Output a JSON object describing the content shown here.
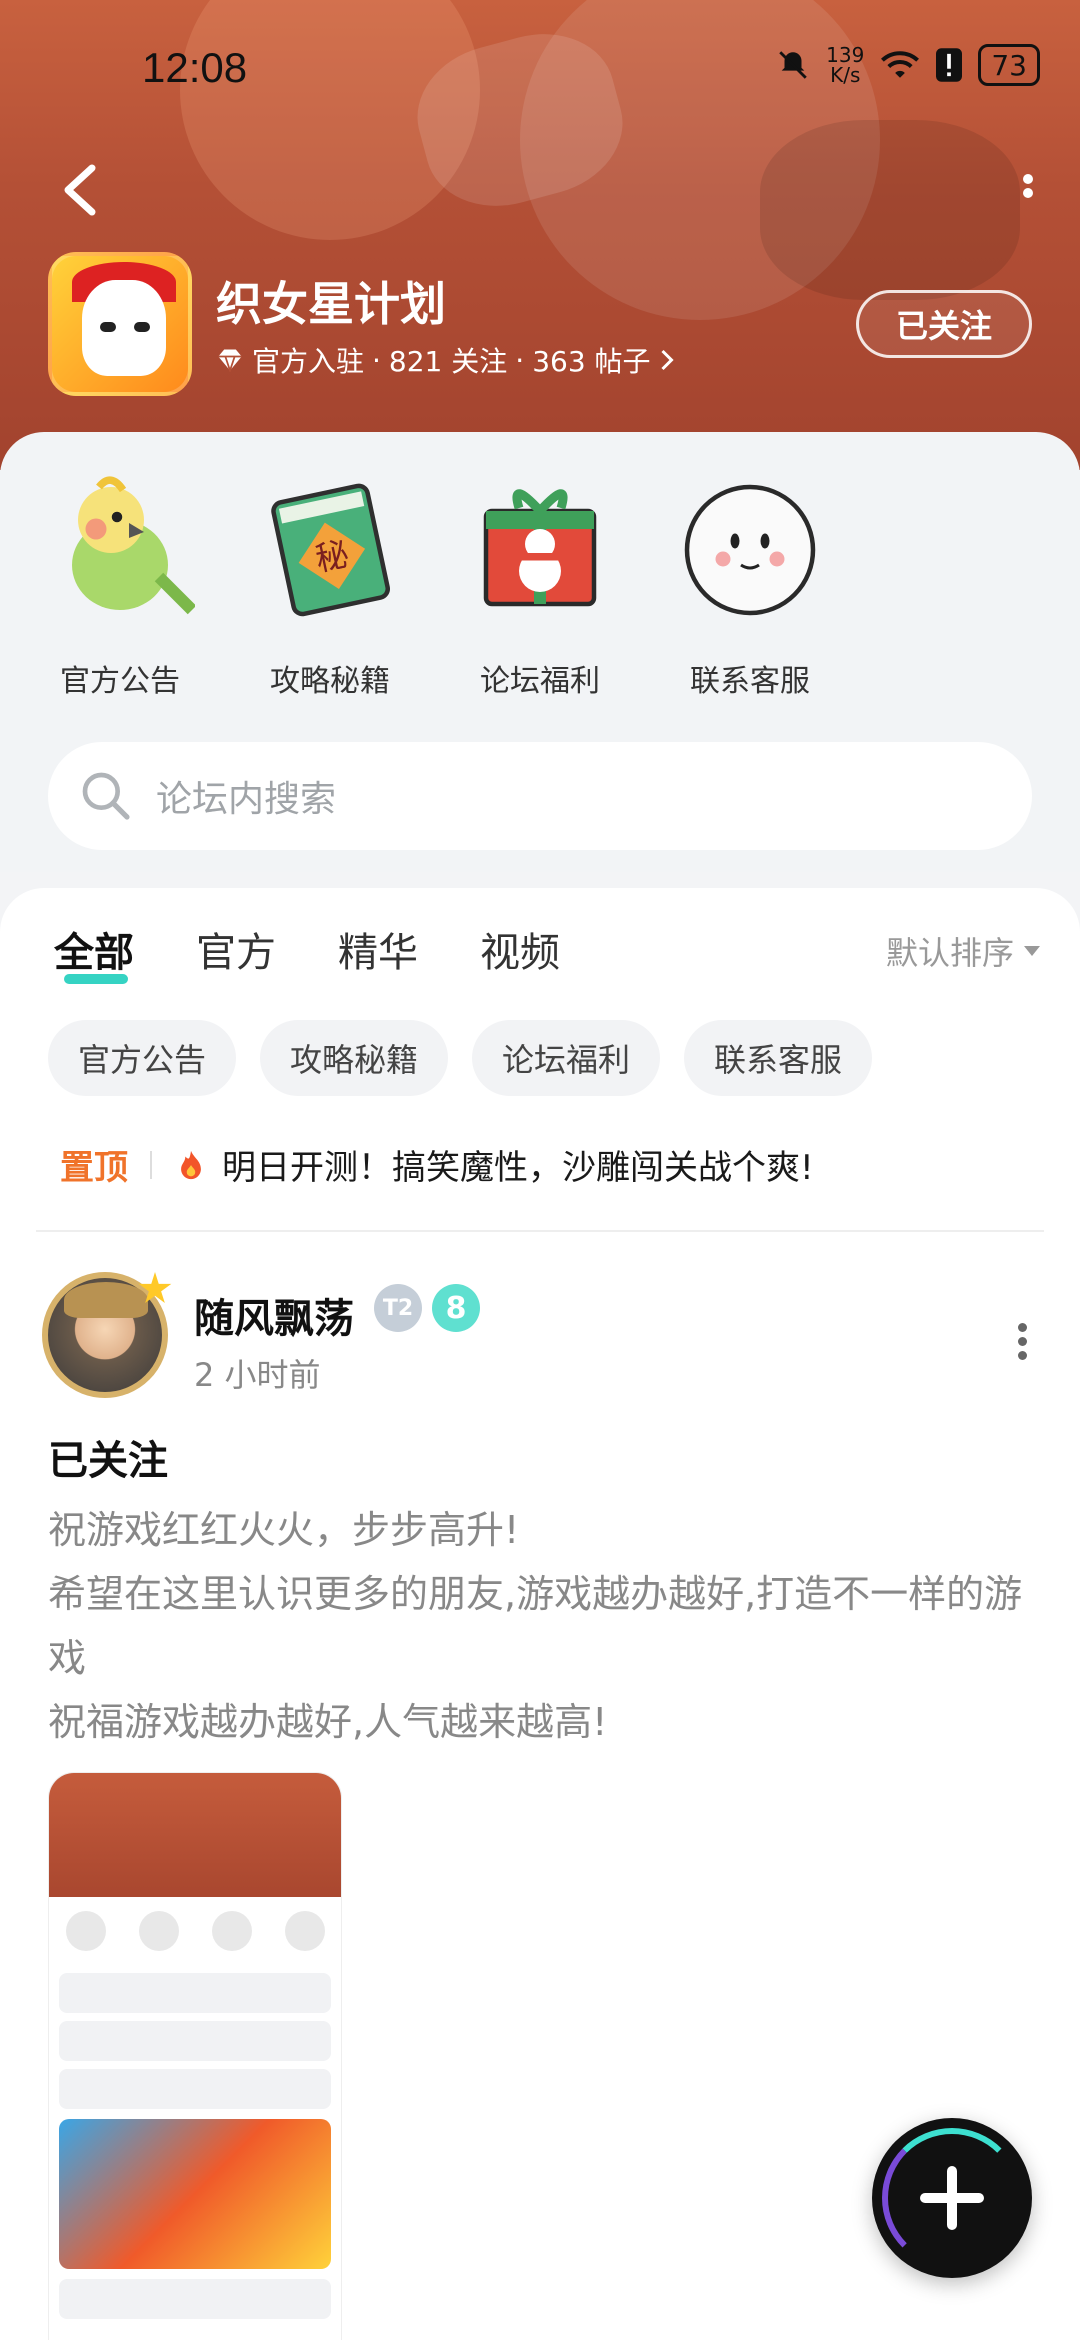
{
  "status_bar": {
    "time": "12:08",
    "speed_value": "139",
    "speed_unit": "K/s",
    "battery": "73"
  },
  "header": {
    "forum_name": "织女星计划",
    "official": "官方入驻",
    "followers": "821 关注",
    "posts": "363 帖子",
    "follow_button": "已关注"
  },
  "shortcuts": [
    {
      "label": "官方公告",
      "icon": "parrot-icon"
    },
    {
      "label": "攻略秘籍",
      "icon": "secret-book-icon"
    },
    {
      "label": "论坛福利",
      "icon": "gift-icon"
    },
    {
      "label": "联系客服",
      "icon": "mascot-icon"
    }
  ],
  "search": {
    "placeholder": "论坛内搜索"
  },
  "tabs": [
    "全部",
    "官方",
    "精华",
    "视频"
  ],
  "sort_label": "默认排序",
  "chips": [
    "官方公告",
    "攻略秘籍",
    "论坛福利",
    "联系客服"
  ],
  "pinned": {
    "tag": "置顶",
    "text": "明日开测！搞笑魔性，沙雕闯关战个爽!"
  },
  "post": {
    "username": "随风飘荡",
    "level_badge": "T2",
    "rank_badge": "8",
    "time": "2 小时前",
    "title": "已关注",
    "body_lines": [
      "祝游戏红红火火，步步高升!",
      "希望在这里认识更多的朋友,游戏越办越好,打造不一样的游戏",
      "祝福游戏越办越好,人气越来越高!"
    ]
  },
  "colors": {
    "header": "#b45036",
    "accent_teal": "#35d3c3",
    "pin_orange": "#f0732a"
  }
}
